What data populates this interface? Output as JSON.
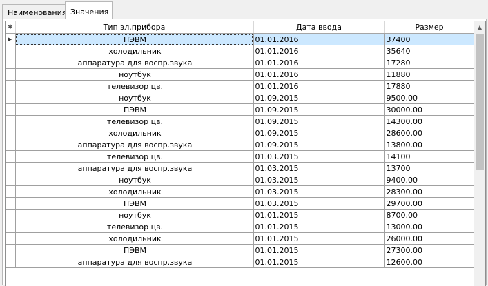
{
  "tabs": [
    {
      "label": "Наименования",
      "active": false
    },
    {
      "label": "Значения",
      "active": true
    }
  ],
  "grid": {
    "corner_icon": "asterisk-icon",
    "corner_glyph": "✱",
    "row_indicator_glyph": "▶",
    "columns": [
      "Тип эл.прибора",
      "Дата ввода",
      "Размер"
    ],
    "rows": [
      [
        "ПЭВМ",
        "01.01.2016",
        "37400"
      ],
      [
        "холодильник",
        "01.01.2016",
        "35640"
      ],
      [
        "аппаратура для воспр.звука",
        "01.01.2016",
        "17280"
      ],
      [
        "ноутбук",
        "01.01.2016",
        "11880"
      ],
      [
        "телевизор цв.",
        "01.01.2016",
        "17880"
      ],
      [
        "ноутбук",
        "01.09.2015",
        "9500.00"
      ],
      [
        "ПЭВМ",
        "01.09.2015",
        "30000.00"
      ],
      [
        "телевизор цв.",
        "01.09.2015",
        "14300.00"
      ],
      [
        "холодильник",
        "01.09.2015",
        "28600.00"
      ],
      [
        "аппаратура для воспр.звука",
        "01.09.2015",
        "13800.00"
      ],
      [
        "телевизор цв.",
        "01.03.2015",
        "14100"
      ],
      [
        "аппаратура для воспр.звука",
        "01.03.2015",
        "13700"
      ],
      [
        "ноутбук",
        "01.03.2015",
        "9400.00"
      ],
      [
        "холодильник",
        "01.03.2015",
        "28300.00"
      ],
      [
        "ПЭВМ",
        "01.03.2015",
        "29700.00"
      ],
      [
        "ноутбук",
        "01.01.2015",
        "8700.00"
      ],
      [
        "телевизор цв.",
        "01.01.2015",
        "13000.00"
      ],
      [
        "холодильник",
        "01.01.2015",
        "26000.00"
      ],
      [
        "ПЭВМ",
        "01.01.2015",
        "27300.00"
      ],
      [
        "аппаратура для воспр.звука",
        "01.01.2015",
        "12600.00"
      ]
    ],
    "selected_row": 0
  },
  "scrollbar": {
    "up_glyph": "▲",
    "position": 0.0,
    "visible_fraction": 0.55
  }
}
